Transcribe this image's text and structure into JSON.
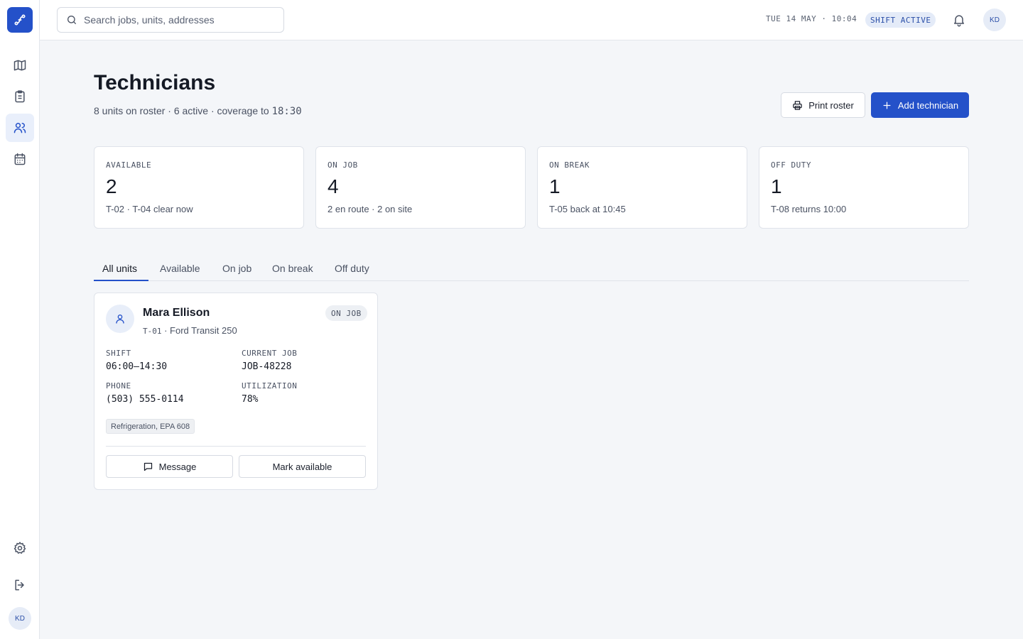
{
  "sidebar": {
    "logo_icon": "route-icon",
    "nav": [
      {
        "name": "map",
        "icon": "map-icon",
        "active": false
      },
      {
        "name": "jobs",
        "icon": "clipboard-icon",
        "active": false
      },
      {
        "name": "technicians",
        "icon": "users-icon",
        "active": true
      },
      {
        "name": "schedule",
        "icon": "calendar-icon",
        "active": false
      }
    ],
    "avatar_initials": "KD"
  },
  "topbar": {
    "search_placeholder": "Search jobs, units, addresses",
    "datetime": "TUE 14 MAY · 10:04",
    "shift_status": "SHIFT ACTIVE",
    "avatar_initials": "KD"
  },
  "header": {
    "title": "Technicians",
    "subtitle_prefix": "8 units on roster · 6 active · coverage to ",
    "coverage_time": "18:30",
    "print_label": "Print roster",
    "add_label": "Add technician"
  },
  "stats": [
    {
      "label": "AVAILABLE",
      "value": "2",
      "note": "T-02 · T-04 clear now"
    },
    {
      "label": "ON JOB",
      "value": "4",
      "note": "2 en route · 2 on site"
    },
    {
      "label": "ON BREAK",
      "value": "1",
      "note": "T-05 back at 10:45"
    },
    {
      "label": "OFF DUTY",
      "value": "1",
      "note": "T-08 returns 10:00"
    }
  ],
  "tabs": [
    {
      "label": "All units",
      "active": true
    },
    {
      "label": "Available",
      "active": false
    },
    {
      "label": "On job",
      "active": false
    },
    {
      "label": "On break",
      "active": false
    },
    {
      "label": "Off duty",
      "active": false
    }
  ],
  "technician": {
    "name": "Mara Ellison",
    "unit_id": "T-01",
    "vehicle": " · Ford Transit 250",
    "status": "ON JOB",
    "shift_label": "SHIFT",
    "shift_value": "06:00–14:30",
    "job_label": "CURRENT JOB",
    "job_value": "JOB-48228",
    "phone_label": "PHONE",
    "phone_value": "(503) 555-0114",
    "util_label": "UTILIZATION",
    "util_value": "78%",
    "skills": "Refrigeration, EPA 608",
    "message_label": "Message",
    "mark_label": "Mark available"
  },
  "colors": {
    "accent": "#2451c9",
    "background": "#f4f6f9",
    "surface": "#ffffff",
    "border": "#dfe3ea"
  }
}
